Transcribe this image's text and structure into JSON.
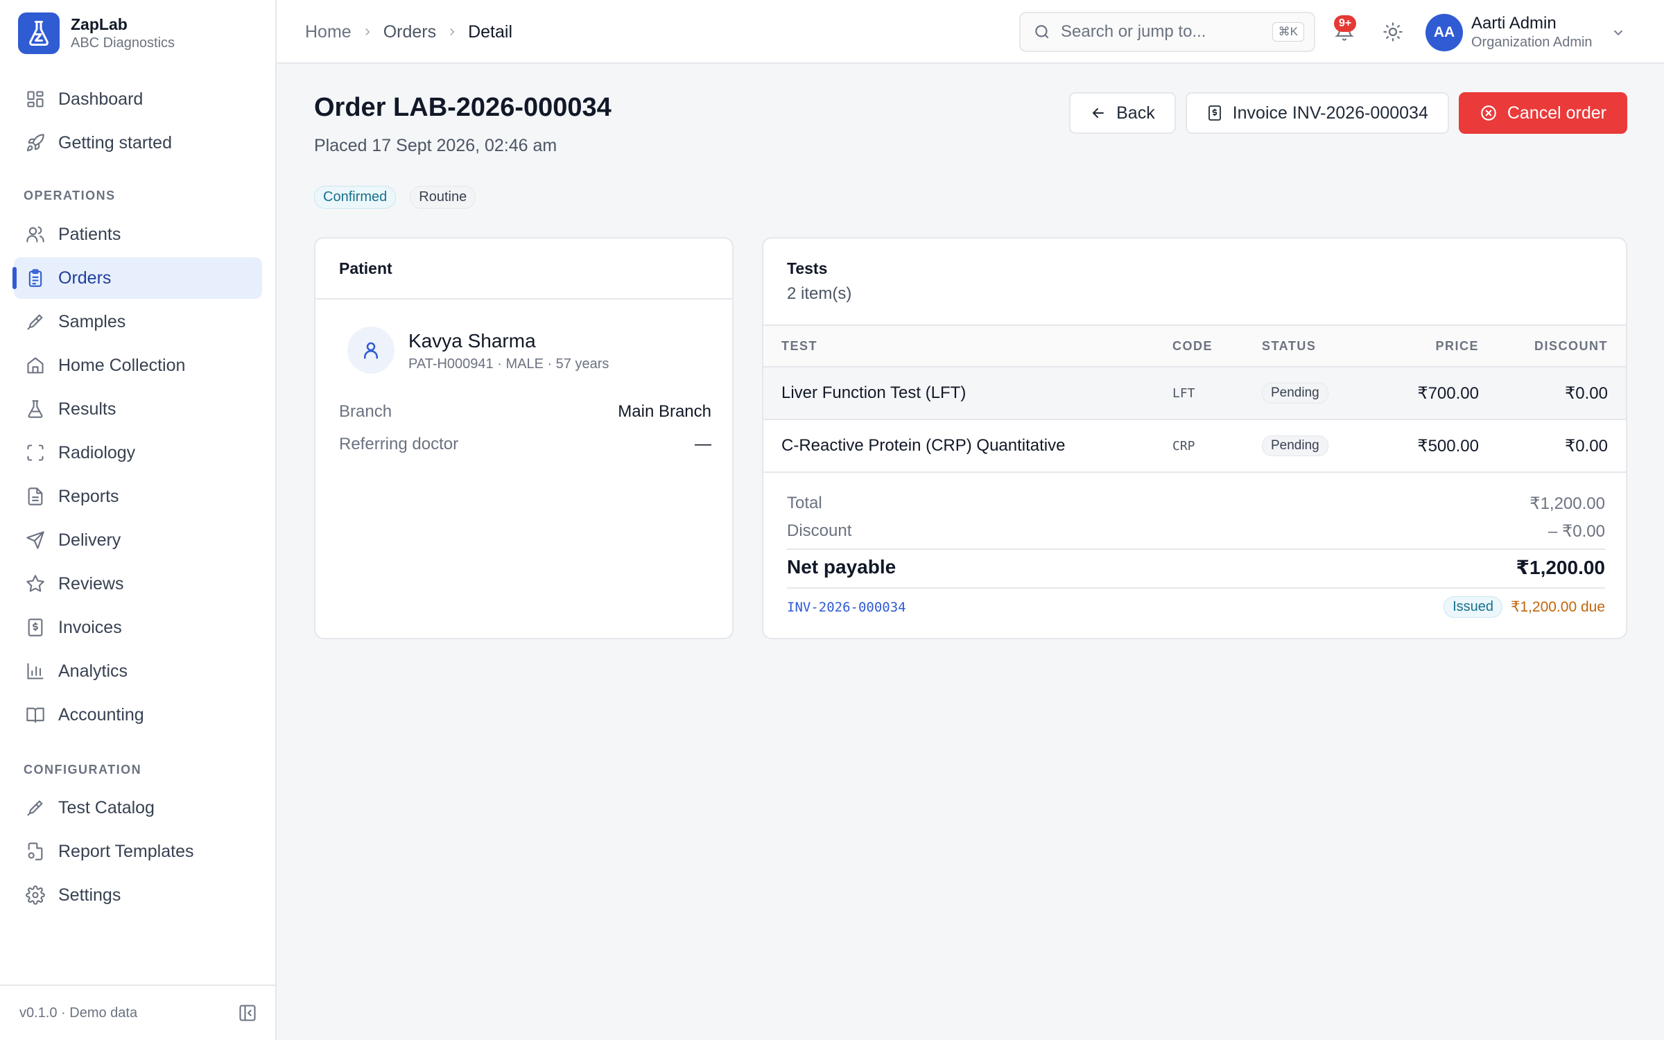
{
  "brand": {
    "name": "ZapLab",
    "org": "ABC Diagnostics"
  },
  "sidebar": {
    "items_top": [
      {
        "label": "Dashboard",
        "icon": "dashboard-icon"
      },
      {
        "label": "Getting started",
        "icon": "rocket-icon"
      }
    ],
    "section_operations": "OPERATIONS",
    "operations": [
      {
        "label": "Patients",
        "icon": "users-icon"
      },
      {
        "label": "Orders",
        "icon": "clipboard-icon",
        "active": true
      },
      {
        "label": "Samples",
        "icon": "pipette-icon"
      },
      {
        "label": "Home Collection",
        "icon": "home-icon"
      },
      {
        "label": "Results",
        "icon": "flask-icon"
      },
      {
        "label": "Radiology",
        "icon": "scan-icon"
      },
      {
        "label": "Reports",
        "icon": "file-icon"
      },
      {
        "label": "Delivery",
        "icon": "send-icon"
      },
      {
        "label": "Reviews",
        "icon": "star-icon"
      },
      {
        "label": "Invoices",
        "icon": "receipt-icon"
      },
      {
        "label": "Analytics",
        "icon": "bar-chart-icon"
      },
      {
        "label": "Accounting",
        "icon": "book-icon"
      }
    ],
    "section_configuration": "CONFIGURATION",
    "configuration": [
      {
        "label": "Test Catalog",
        "icon": "pipette-icon"
      },
      {
        "label": "Report Templates",
        "icon": "file-settings-icon"
      },
      {
        "label": "Settings",
        "icon": "gear-icon"
      }
    ],
    "footer": "v0.1.0 · Demo data"
  },
  "topbar": {
    "breadcrumb": [
      "Home",
      "Orders",
      "Detail"
    ],
    "search_placeholder": "Search or jump to...",
    "search_shortcut": "⌘K",
    "notification_badge": "9+",
    "user_initials": "AA",
    "user_name": "Aarti Admin",
    "user_role": "Organization Admin"
  },
  "order": {
    "title": "Order LAB-2026-000034",
    "placed": "Placed 17 Sept 2026, 02:46 am",
    "status_badge": "Confirmed",
    "priority_badge": "Routine",
    "back_label": "Back",
    "invoice_label": "Invoice INV-2026-000034",
    "cancel_label": "Cancel order"
  },
  "patient": {
    "heading": "Patient",
    "name": "Kavya Sharma",
    "meta": "PAT-H000941 · MALE · 57 years",
    "branch_label": "Branch",
    "branch_value": "Main Branch",
    "doctor_label": "Referring doctor",
    "doctor_value": "—"
  },
  "tests": {
    "heading": "Tests",
    "count": "2 item(s)",
    "columns": {
      "test": "TEST",
      "code": "CODE",
      "status": "STATUS",
      "price": "PRICE",
      "discount": "DISCOUNT"
    },
    "rows": [
      {
        "test": "Liver Function Test (LFT)",
        "code": "LFT",
        "status": "Pending",
        "price": "₹700.00",
        "discount": "₹0.00"
      },
      {
        "test": "C-Reactive Protein (CRP) Quantitative",
        "code": "CRP",
        "status": "Pending",
        "price": "₹500.00",
        "discount": "₹0.00"
      }
    ],
    "total_label": "Total",
    "total_value": "₹1,200.00",
    "discount_label": "Discount",
    "discount_value": "– ₹0.00",
    "net_label": "Net payable",
    "net_value": "₹1,200.00",
    "invoice_id": "INV-2026-000034",
    "invoice_status": "Issued",
    "invoice_due": "₹1,200.00 due"
  },
  "colors": {
    "accent": "#2f5bd3",
    "danger": "#ea3a3a",
    "due": "#c2650b",
    "confirmed": "#16708c"
  }
}
